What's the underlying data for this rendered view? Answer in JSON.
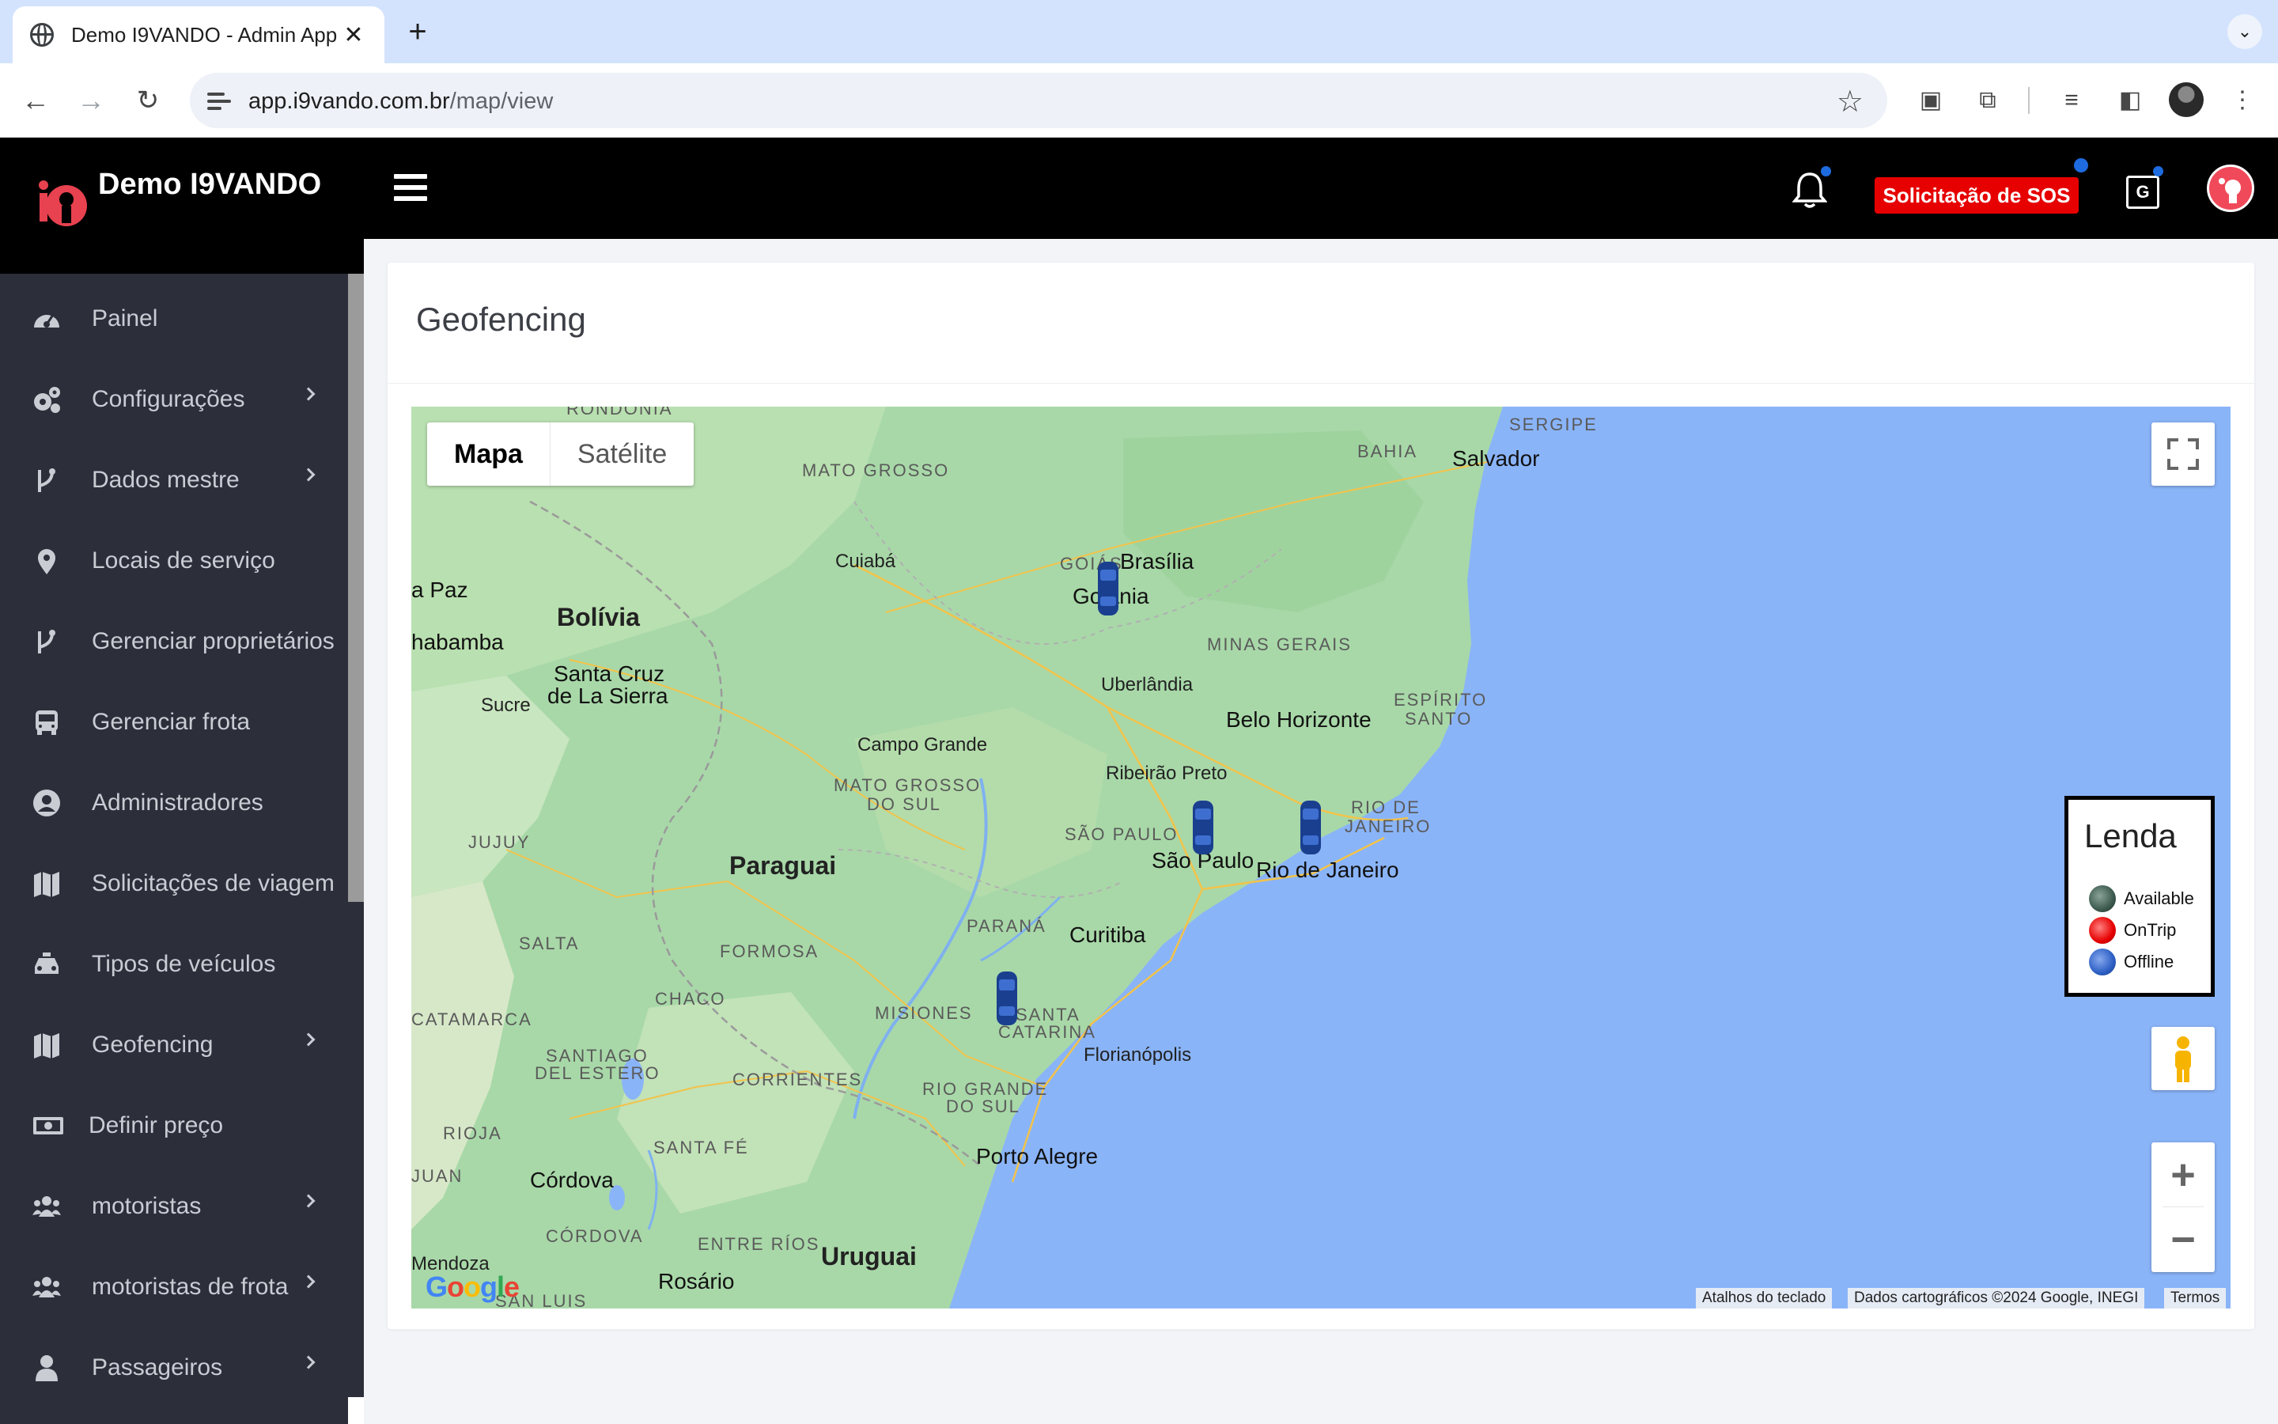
{
  "browser": {
    "tab_title": "Demo I9VANDO - Admin App",
    "tab_close": "✕",
    "new_tab": "+",
    "tab_menu": "⌄",
    "url_host": "app.i9vando.com.br",
    "url_path": "/map/view"
  },
  "app": {
    "brand": "Demo I9VANDO",
    "sos_label": "Solicitação de SOS",
    "translate_glyph": "G"
  },
  "sidebar": {
    "items": [
      {
        "label": "Painel",
        "icon": "dashboard-icon",
        "has_submenu": false
      },
      {
        "label": "Configurações",
        "icon": "gears-icon",
        "has_submenu": true
      },
      {
        "label": "Dados mestre",
        "icon": "branch-icon",
        "has_submenu": true
      },
      {
        "label": "Locais de serviço",
        "icon": "map-pin-icon",
        "has_submenu": false
      },
      {
        "label": "Gerenciar proprietários",
        "icon": "branch-icon",
        "has_submenu": false
      },
      {
        "label": "Gerenciar frota",
        "icon": "bus-icon",
        "has_submenu": false
      },
      {
        "label": "Administradores",
        "icon": "user-circle-icon",
        "has_submenu": false
      },
      {
        "label": "Solicitações de viagem",
        "icon": "map-icon",
        "has_submenu": false
      },
      {
        "label": "Tipos de veículos",
        "icon": "taxi-icon",
        "has_submenu": false
      },
      {
        "label": "Geofencing",
        "icon": "map-icon",
        "has_submenu": true
      },
      {
        "label": "Definir preço",
        "icon": "money-icon",
        "has_submenu": false
      },
      {
        "label": "motoristas",
        "icon": "users-icon",
        "has_submenu": true
      },
      {
        "label": "motoristas de frota",
        "icon": "users-icon",
        "has_submenu": true
      },
      {
        "label": "Passageiros",
        "icon": "user-icon",
        "has_submenu": true
      }
    ]
  },
  "page": {
    "title": "Geofencing"
  },
  "map": {
    "type_map": "Mapa",
    "type_satellite": "Satélite",
    "legend_title": "Lenda",
    "legend": [
      {
        "label": "Available",
        "color": "#3d5a4f"
      },
      {
        "label": "OnTrip",
        "color": "#e60000"
      },
      {
        "label": "Offline",
        "color": "#2d5fc4"
      }
    ],
    "zoom_in": "+",
    "zoom_out": "−",
    "attribution_shortcuts": "Atalhos do teclado",
    "attribution_data": "Dados cartográficos ©2024 Google, INEGI",
    "attribution_terms": "Termos",
    "google": "Google",
    "labels": {
      "rondonia": "RONDÔNIA",
      "mato_grosso": "MATO GROSSO",
      "bahia": "BAHIA",
      "sergipe": "SERGIPE",
      "salvador": "Salvador",
      "cuiaba": "Cuiabá",
      "goias": "GOIÁS",
      "brasilia": "Brasília",
      "goiania": "Goiânia",
      "la_paz": "a Paz",
      "bolivia": "Bolívia",
      "cochabamba": "habamba",
      "minas_gerais": "MINAS GERAIS",
      "uberlandia": "Uberlândia",
      "santa_cruz": "Santa Cruz",
      "de_la_sierra": "de La Sierra",
      "sucre": "Sucre",
      "belo_horizonte": "Belo Horizonte",
      "espirito_santo_1": "ESPÍRITO",
      "espirito_santo_2": "SANTO",
      "campo_grande": "Campo Grande",
      "ribeirao_preto": "Ribeirão Preto",
      "mato_grosso_sul_1": "MATO GROSSO",
      "mato_grosso_sul_2": "DO SUL",
      "rio_state_1": "RIO DE",
      "rio_state_2": "JANEIRO",
      "sao_paulo_state": "SÃO PAULO",
      "jujuy": "JUJUY",
      "paraguai": "Paraguai",
      "sao_paulo": "São Paulo",
      "rio_de_janeiro": "Rio de Janeiro",
      "parana": "PARANÁ",
      "curitiba": "Curitiba",
      "salta": "SALTA",
      "formosa": "FORMOSA",
      "chaco": "CHACO",
      "misiones": "MISIONES",
      "santa_catarina_1": "SANTA",
      "santa_catarina_2": "CATARINA",
      "catamarca": "CATAMARCA",
      "florianopolis": "Florianópolis",
      "santiago_1": "SANTIAGO",
      "santiago_2": "DEL ESTERO",
      "corrientes": "CORRIENTES",
      "rio_grande_1": "RIO GRANDE",
      "rio_grande_2": "DO SUL",
      "rioja": "RIOJA",
      "santa_fe": "SANTA FÉ",
      "porto_alegre": "Porto Alegre",
      "juan": "JUAN",
      "cordoba_city": "Córdova",
      "cordoba_state": "CÓRDOVA",
      "entre_rios": "ENTRE RÍOS",
      "uruguai": "Uruguai",
      "mendoza": "Mendoza",
      "rosario": "Rosário",
      "san_luis": "SAN LUIS"
    }
  }
}
